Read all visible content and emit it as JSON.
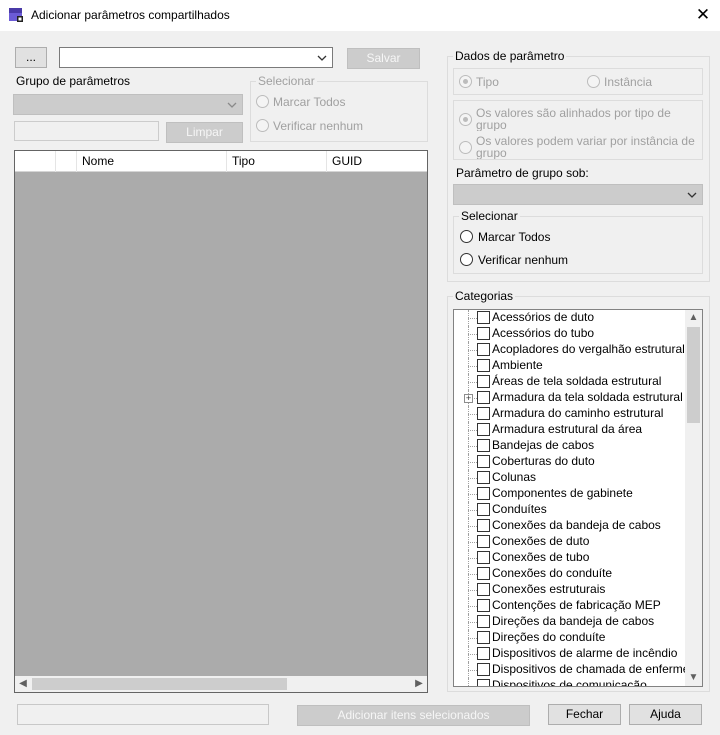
{
  "window": {
    "title": "Adicionar parâmetros compartilhados"
  },
  "top_left": {
    "browse_label": "...",
    "file_value": "",
    "save_label": "Salvar"
  },
  "param_group": {
    "label": "Grupo de parâmetros",
    "value": "",
    "filter_value": "",
    "clear_label": "Limpar"
  },
  "select_left": {
    "title": "Selecionar",
    "check_all": "Marcar Todos",
    "check_none": "Verificar nenhum"
  },
  "grid": {
    "columns": [
      "",
      "",
      "Nome",
      "Tipo",
      "GUID"
    ]
  },
  "param_data": {
    "title": "Dados de parâmetro",
    "type_label": "Tipo",
    "instance_label": "Instância",
    "type_checked": true,
    "aligned_label": "Os valores são alinhados por tipo de grupo",
    "vary_label": "Os valores podem variar por instância de grupo",
    "group_under_label": "Parâmetro de grupo sob:",
    "group_under_value": ""
  },
  "select_right": {
    "title": "Selecionar",
    "check_all": "Marcar Todos",
    "check_none": "Verificar nenhum"
  },
  "categories": {
    "title": "Categorias",
    "items": [
      {
        "label": "Acessórios de duto",
        "expandable": false
      },
      {
        "label": "Acessórios do tubo",
        "expandable": false
      },
      {
        "label": "Acopladores do vergalhão estrutural",
        "expandable": false
      },
      {
        "label": "Ambiente",
        "expandable": false
      },
      {
        "label": "Áreas de tela soldada estrutural",
        "expandable": false
      },
      {
        "label": "Armadura da tela soldada estrutural",
        "expandable": true
      },
      {
        "label": "Armadura do caminho estrutural",
        "expandable": false
      },
      {
        "label": "Armadura estrutural da área",
        "expandable": false
      },
      {
        "label": "Bandejas de cabos",
        "expandable": false
      },
      {
        "label": "Coberturas do duto",
        "expandable": false
      },
      {
        "label": "Colunas",
        "expandable": false
      },
      {
        "label": "Componentes de gabinete",
        "expandable": false
      },
      {
        "label": "Conduítes",
        "expandable": false
      },
      {
        "label": "Conexões da bandeja de cabos",
        "expandable": false
      },
      {
        "label": "Conexões de duto",
        "expandable": false
      },
      {
        "label": "Conexões de tubo",
        "expandable": false
      },
      {
        "label": "Conexões do conduíte",
        "expandable": false
      },
      {
        "label": "Conexões estruturais",
        "expandable": false
      },
      {
        "label": "Contenções de fabricação MEP",
        "expandable": false
      },
      {
        "label": "Direções da bandeja de cabos",
        "expandable": false
      },
      {
        "label": "Direções do conduíte",
        "expandable": false
      },
      {
        "label": "Dispositivos de alarme de incêndio",
        "expandable": false
      },
      {
        "label": "Dispositivos de chamada de enfermeira",
        "expandable": false
      },
      {
        "label": "Dispositivos de comunicação",
        "expandable": false
      }
    ]
  },
  "footer": {
    "status_value": "",
    "add_selected_label": "Adicionar itens selecionados",
    "close_label": "Fechar",
    "help_label": "Ajuda"
  }
}
